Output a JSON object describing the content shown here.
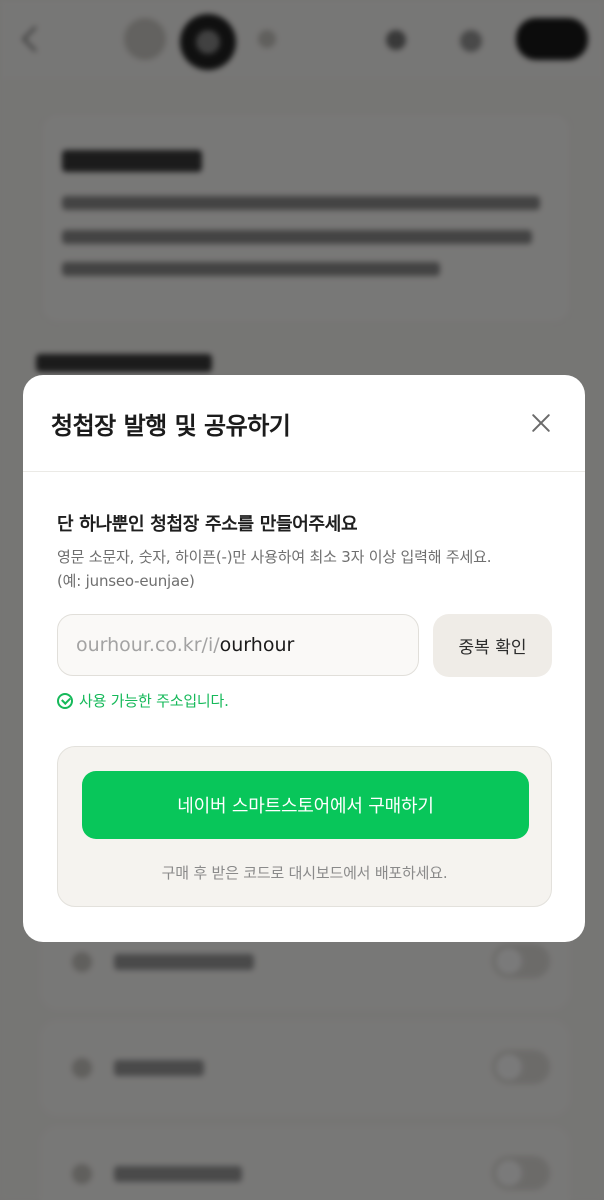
{
  "modal": {
    "title": "청첩장 발행 및 공유하기",
    "section_title": "단 하나뿐인 청첩장 주소를 만들어주세요",
    "hint_line1": "영문 소문자, 숫자, 하이픈(-)만 사용하여 최소 3자 이상 입력해 주세요.",
    "hint_line2": "(예: junseo-eunjae)",
    "url_prefix": "ourhour.co.kr/i/",
    "url_value": "ourhour",
    "check_button": "중복 확인",
    "status_message": "사용 가능한 주소입니다.",
    "purchase_button": "네이버 스마트스토어에서 구매하기",
    "purchase_note": "구매 후 받은 코드로 대시보드에서 배포하세요."
  },
  "colors": {
    "accent_green": "#08c65a",
    "status_green": "#16b95a",
    "overlay": "rgba(0,0,0,0.52)"
  },
  "icons": {
    "close": "close-icon",
    "status": "check-circle-icon"
  }
}
